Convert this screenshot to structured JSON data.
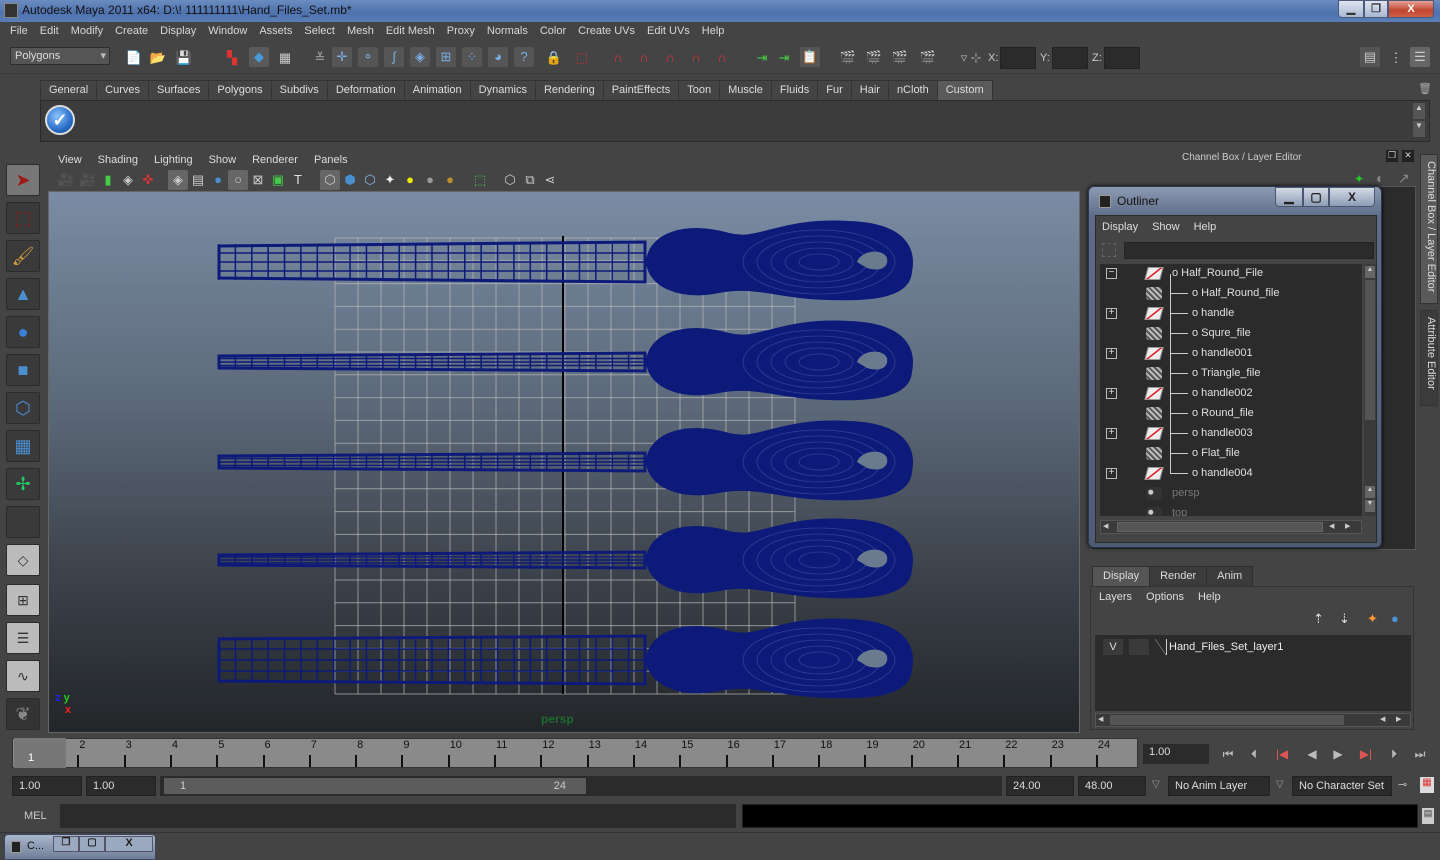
{
  "window": {
    "title": "Autodesk Maya 2011 x64: D:\\! 111111111\\Hand_Files_Set.mb*",
    "controls": {
      "minimize": "▁",
      "maximize": "❐",
      "close": "X"
    }
  },
  "menubar": [
    "File",
    "Edit",
    "Modify",
    "Create",
    "Display",
    "Window",
    "Assets",
    "Select",
    "Mesh",
    "Edit Mesh",
    "Proxy",
    "Normals",
    "Color",
    "Create UVs",
    "Edit UVs",
    "Help"
  ],
  "statusline": {
    "menu_set": "Polygons",
    "x_label": "X:",
    "y_label": "Y:",
    "z_label": "Z:",
    "x_value": "",
    "y_value": "",
    "z_value": ""
  },
  "shelf": {
    "tabs": [
      "General",
      "Curves",
      "Surfaces",
      "Polygons",
      "Subdivs",
      "Deformation",
      "Animation",
      "Dynamics",
      "Rendering",
      "PaintEffects",
      "Toon",
      "Muscle",
      "Fluids",
      "Fur",
      "Hair",
      "nCloth",
      "Custom"
    ],
    "active_tab": "Custom",
    "items": [
      "checkmark-tool"
    ]
  },
  "toolbox": [
    "select-tool",
    "lasso-tool",
    "paint-select-tool",
    "move-tool",
    "rotate-tool",
    "scale-tool",
    "universal-manipulator",
    "soft-modification-tool",
    "show-manipulator",
    "last-tool-used"
  ],
  "layouts": [
    "single-perspective-layout",
    "four-view-layout",
    "outliner-persp-layout",
    "graph-persp-layout",
    "layouts-menu"
  ],
  "viewport": {
    "menu": [
      "View",
      "Shading",
      "Lighting",
      "Show",
      "Renderer",
      "Panels"
    ],
    "camera_label": "persp",
    "axis": {
      "z": "z",
      "y": "y",
      "x": "x"
    },
    "wire_color": "#0d1a7a",
    "objects": [
      {
        "name": "Half_Round_file",
        "blade": "half-round"
      },
      {
        "name": "Squre_file",
        "blade": "square"
      },
      {
        "name": "Triangle_file",
        "blade": "triangle"
      },
      {
        "name": "Round_file",
        "blade": "round"
      },
      {
        "name": "Flat_file",
        "blade": "flat"
      }
    ]
  },
  "dock": {
    "title": "Channel Box / Layer Editor",
    "side_tabs": [
      "Channel Box / Layer Editor",
      "Attribute Editor"
    ]
  },
  "outliner": {
    "title": "Outliner",
    "menu": [
      "Display",
      "Show",
      "Help"
    ],
    "filter_value": "",
    "items": [
      {
        "label": "Half_Round_File",
        "type": "transform",
        "expander": "−",
        "depth": 0
      },
      {
        "label": "Half_Round_file",
        "type": "mesh",
        "expander": "",
        "depth": 1
      },
      {
        "label": "handle",
        "type": "transform",
        "expander": "+",
        "depth": 1
      },
      {
        "label": "Squre_file",
        "type": "mesh",
        "expander": "",
        "depth": 1
      },
      {
        "label": "handle001",
        "type": "transform",
        "expander": "+",
        "depth": 1
      },
      {
        "label": "Triangle_file",
        "type": "mesh",
        "expander": "",
        "depth": 1
      },
      {
        "label": "handle002",
        "type": "transform",
        "expander": "+",
        "depth": 1
      },
      {
        "label": "Round_file",
        "type": "mesh",
        "expander": "",
        "depth": 1
      },
      {
        "label": "handle003",
        "type": "transform",
        "expander": "+",
        "depth": 1
      },
      {
        "label": "Flat_file",
        "type": "mesh",
        "expander": "",
        "depth": 1
      },
      {
        "label": "handle004",
        "type": "transform",
        "expander": "+",
        "depth": 1
      },
      {
        "label": "persp",
        "type": "camera",
        "expander": "",
        "depth": 0
      },
      {
        "label": "top",
        "type": "camera",
        "expander": "",
        "depth": 0
      }
    ]
  },
  "layer_editor": {
    "tabs": [
      "Display",
      "Render",
      "Anim"
    ],
    "active_tab": "Display",
    "menu": [
      "Layers",
      "Options",
      "Help"
    ],
    "layers": [
      {
        "visible": "V",
        "name": "Hand_Files_Set_layer1"
      }
    ]
  },
  "timeline": {
    "ticks": [
      "1",
      "2",
      "3",
      "4",
      "5",
      "6",
      "7",
      "8",
      "9",
      "10",
      "11",
      "12",
      "13",
      "14",
      "15",
      "16",
      "17",
      "18",
      "19",
      "20",
      "21",
      "22",
      "23",
      "24"
    ],
    "current_frame_marker": "1",
    "current_time": "1.00",
    "playback_buttons": [
      "go-to-start",
      "step-back-frame",
      "step-back-key",
      "play-backwards",
      "play-forwards",
      "step-forward-key",
      "step-forward-frame",
      "go-to-end"
    ]
  },
  "range": {
    "start_time": "1.00",
    "playback_start": "1.00",
    "range_start_label": "1",
    "range_end_label": "24",
    "playback_end": "24.00",
    "end_time": "48.00",
    "anim_layer": "No Anim Layer",
    "character_set": "No Character Set"
  },
  "command_line": {
    "label": "MEL",
    "input": "",
    "output": ""
  },
  "minimized_window": {
    "label": "C..."
  }
}
